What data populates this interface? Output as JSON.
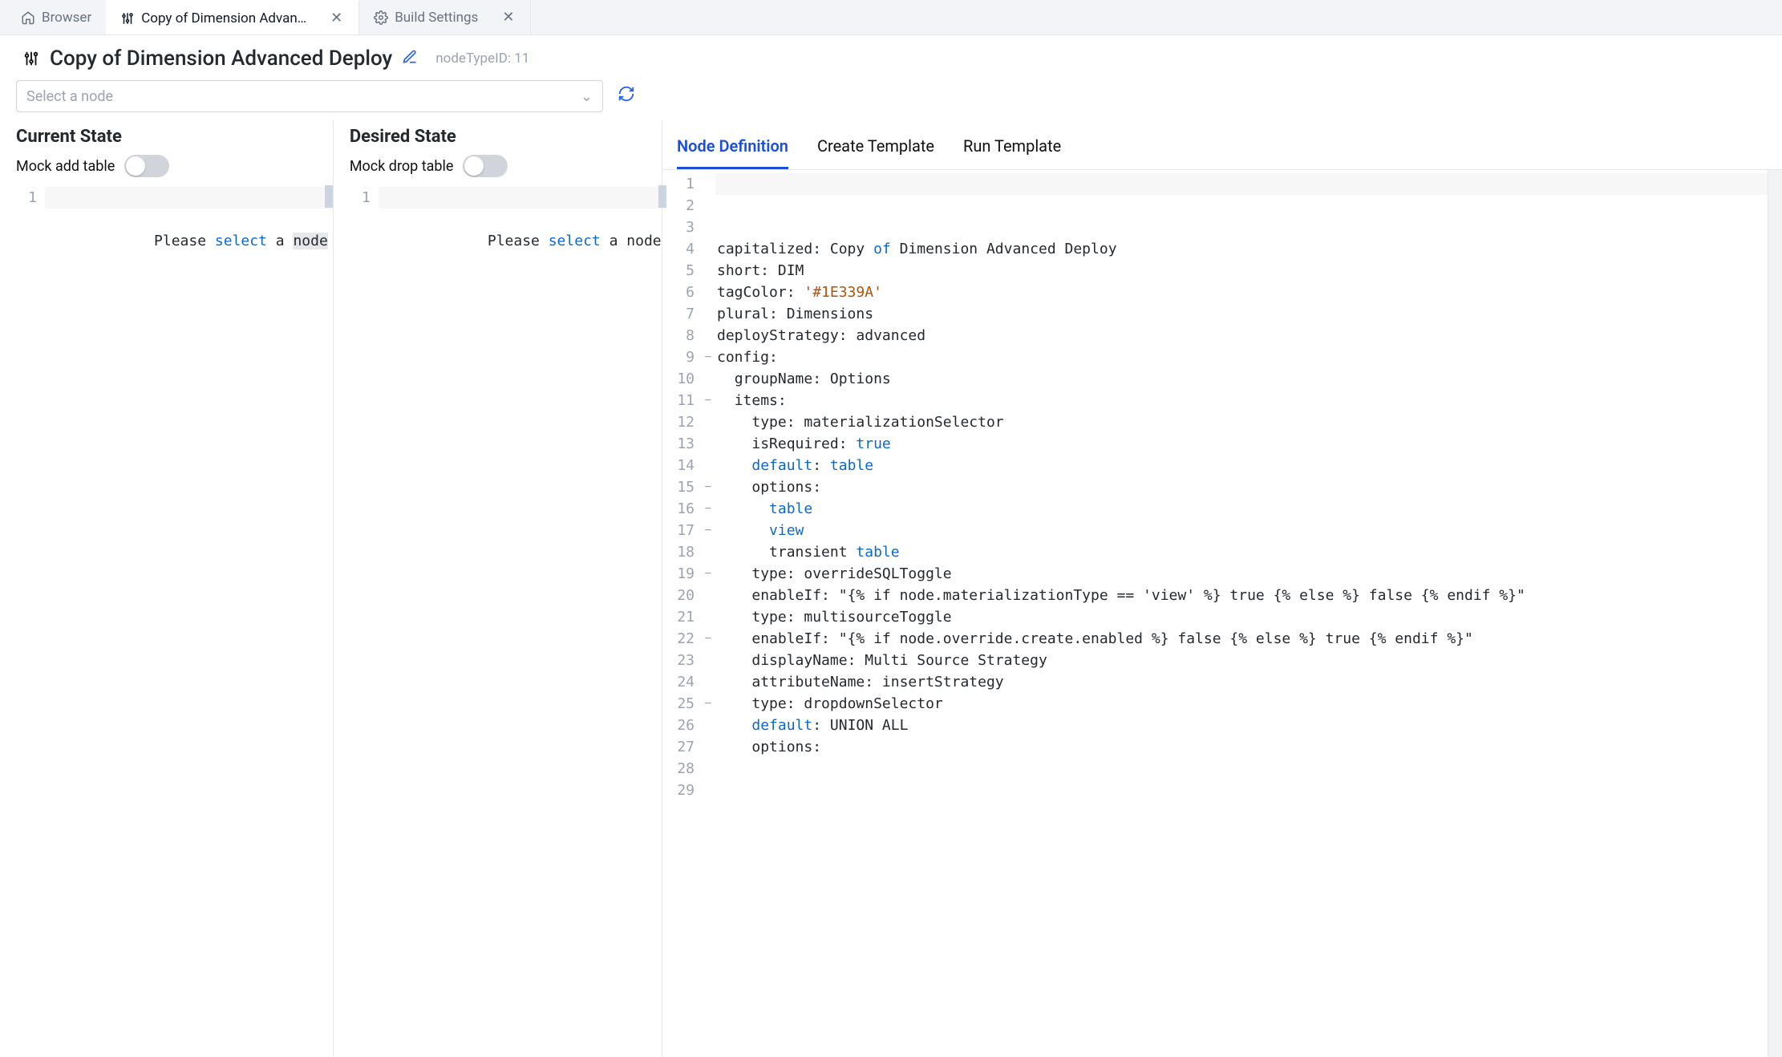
{
  "tabs": {
    "browser_label": "Browser",
    "active_label": "Copy of Dimension Advan…",
    "build_label": "Build Settings"
  },
  "header": {
    "title": "Copy of Dimension Advanced Deploy",
    "meta": "nodeTypeID: 11"
  },
  "select": {
    "placeholder": "Select a node"
  },
  "states": {
    "current_title": "Current State",
    "desired_title": "Desired State",
    "mock_add_label": "Mock add table",
    "mock_drop_label": "Mock drop table",
    "msg_head": "Please ",
    "msg_select": "select",
    "msg_tail_a": " a ",
    "msg_tail_node": "node"
  },
  "rtabs": {
    "def": "Node Definition",
    "create": "Create Template",
    "run": "Run Template"
  },
  "yaml": {
    "lines": [
      {
        "n": 1,
        "fold": "",
        "t": "capitalized: Copy ",
        "kw": "of",
        "rest": " Dimension Advanced Deploy"
      },
      {
        "n": 2,
        "fold": "",
        "t": "short: DIM"
      },
      {
        "n": 3,
        "fold": "",
        "t": "tagColor: ",
        "str": "'#1E339A'"
      },
      {
        "n": 4,
        "fold": "",
        "t": "plural: Dimensions"
      },
      {
        "n": 5,
        "fold": "",
        "t": ""
      },
      {
        "n": 6,
        "fold": "",
        "t": "deployStrategy: advanced"
      },
      {
        "n": 7,
        "fold": "",
        "t": ""
      },
      {
        "n": 8,
        "fold": "",
        "t": "config:"
      },
      {
        "n": 9,
        "fold": "−",
        "t": "  groupName: Options"
      },
      {
        "n": 10,
        "fold": "",
        "t": "  items:"
      },
      {
        "n": 11,
        "fold": "−",
        "t": "    type: materializationSelector"
      },
      {
        "n": 12,
        "fold": "",
        "t": "    isRequired: ",
        "kw": "true"
      },
      {
        "n": 13,
        "fold": "",
        "pre": "    ",
        "kw2": "default",
        "mid": ": ",
        "kw": "table"
      },
      {
        "n": 14,
        "fold": "",
        "t": "    options:"
      },
      {
        "n": 15,
        "fold": "−",
        "t": "      ",
        "kw": "table"
      },
      {
        "n": 16,
        "fold": "−",
        "t": "      ",
        "kw": "view"
      },
      {
        "n": 17,
        "fold": "−",
        "t": "      transient ",
        "kw": "table"
      },
      {
        "n": 18,
        "fold": "",
        "t": ""
      },
      {
        "n": 19,
        "fold": "−",
        "t": "    type: overrideSQLToggle"
      },
      {
        "n": 20,
        "fold": "",
        "t": "    enableIf: \"{% if node.materializationType == 'view' %} true {% else %} false {% endif %}\""
      },
      {
        "n": 21,
        "fold": "",
        "t": ""
      },
      {
        "n": 22,
        "fold": "−",
        "t": "    type: multisourceToggle"
      },
      {
        "n": 23,
        "fold": "",
        "t": "    enableIf: \"{% if node.override.create.enabled %} false {% else %} true {% endif %}\""
      },
      {
        "n": 24,
        "fold": "",
        "t": ""
      },
      {
        "n": 25,
        "fold": "−",
        "t": "    displayName: Multi Source Strategy"
      },
      {
        "n": 26,
        "fold": "",
        "t": "    attributeName: insertStrategy"
      },
      {
        "n": 27,
        "fold": "",
        "t": "    type: dropdownSelector"
      },
      {
        "n": 28,
        "fold": "",
        "pre": "    ",
        "kw2": "default",
        "mid": ": UNION ALL"
      },
      {
        "n": 29,
        "fold": "",
        "t": "    options:"
      }
    ]
  }
}
